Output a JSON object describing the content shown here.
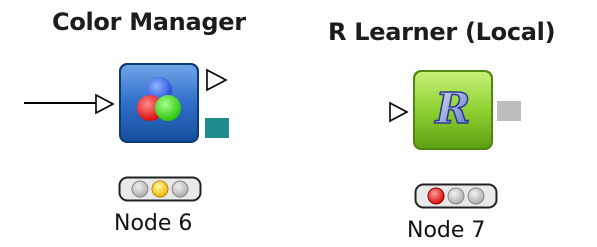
{
  "canvas": {
    "background": "#ffffff"
  },
  "nodes": [
    {
      "title": "Color Manager",
      "label": "Node 6",
      "icon": "color-manager-icon",
      "status": "configured",
      "status_lights": [
        "off",
        "yellow",
        "off"
      ],
      "colors": {
        "icon_bg": "#1f5fb5",
        "output_model_port": "#1e8c8c"
      }
    },
    {
      "title": "R Learner (Local)",
      "label": "Node 7",
      "icon": "r-logo-icon",
      "status": "not-configured",
      "status_lights": [
        "red",
        "off",
        "off"
      ],
      "colors": {
        "icon_bg": "#82c92e",
        "output_model_port": "#bdbdbd"
      }
    }
  ]
}
